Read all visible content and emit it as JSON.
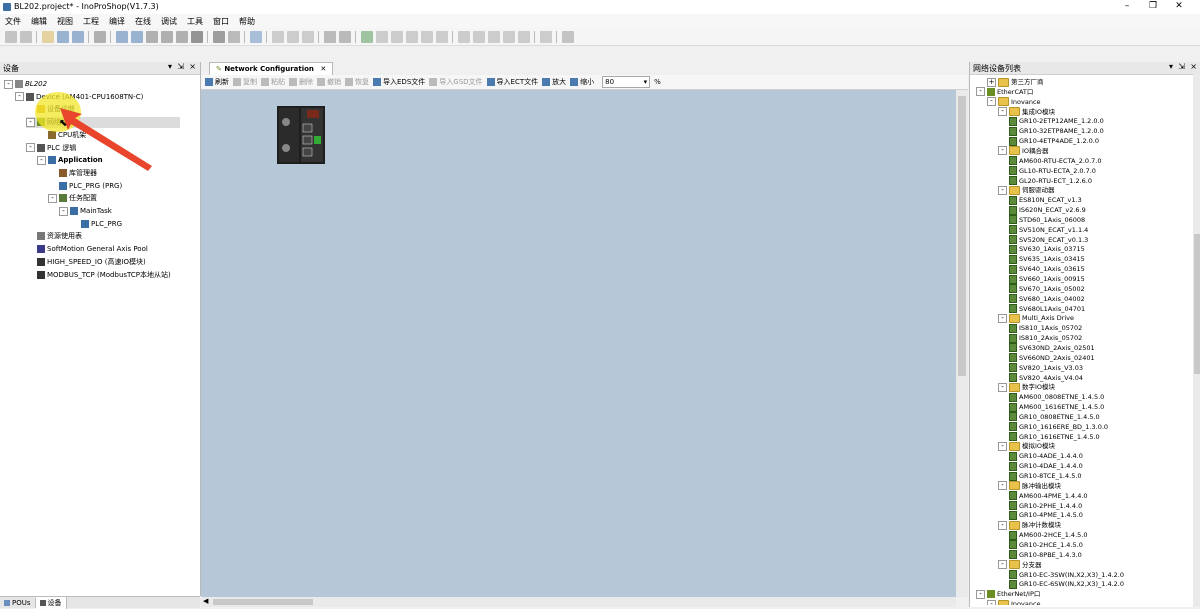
{
  "window": {
    "title": "BL202.project* - InoProShop(V1.7.3)"
  },
  "menu": [
    "文件",
    "编辑",
    "视图",
    "工程",
    "编译",
    "在线",
    "调试",
    "工具",
    "窗口",
    "帮助"
  ],
  "left_panel": {
    "title": "设备",
    "tree": [
      {
        "label": "BL202",
        "indent": 0,
        "exp": "-",
        "icon": "project"
      },
      {
        "label": "Device (AM401-CPU1608TN-C)",
        "indent": 1,
        "exp": "-",
        "icon": "device"
      },
      {
        "label": "设备诊断",
        "indent": 2,
        "exp": "",
        "icon": "diag"
      },
      {
        "label": "网络组态",
        "indent": 2,
        "exp": "-",
        "icon": "net"
      },
      {
        "label": "CPU机架",
        "indent": 3,
        "exp": "",
        "icon": "rack"
      },
      {
        "label": "PLC 逻辑",
        "indent": 2,
        "exp": "-",
        "icon": "plc"
      },
      {
        "label": "Application",
        "indent": 3,
        "exp": "-",
        "icon": "app"
      },
      {
        "label": "库管理器",
        "indent": 4,
        "exp": "",
        "icon": "lib"
      },
      {
        "label": "PLC_PRG (PRG)",
        "indent": 4,
        "exp": "",
        "icon": "prg"
      },
      {
        "label": "任务配置",
        "indent": 4,
        "exp": "-",
        "icon": "task"
      },
      {
        "label": "MainTask",
        "indent": 5,
        "exp": "-",
        "icon": "maintask"
      },
      {
        "label": "PLC_PRG",
        "indent": 6,
        "exp": "",
        "icon": "prg"
      },
      {
        "label": "资源使用表",
        "indent": 2,
        "exp": "",
        "icon": "res"
      },
      {
        "label": "SoftMotion General Axis Pool",
        "indent": 2,
        "exp": "",
        "icon": "axis"
      },
      {
        "label": "HIGH_SPEED_IO (高速IO模块)",
        "indent": 2,
        "exp": "",
        "icon": "hsio"
      },
      {
        "label": "MODBUS_TCP (ModbusTCP本地从站)",
        "indent": 2,
        "exp": "",
        "icon": "modbus"
      }
    ],
    "bottom_tabs": [
      "POUs",
      "设备"
    ]
  },
  "editor": {
    "tab_label": "Network Configuration",
    "toolbar": [
      {
        "label": "刷新",
        "disabled": false
      },
      {
        "label": "复制",
        "disabled": true
      },
      {
        "label": "粘贴",
        "disabled": true
      },
      {
        "label": "删除",
        "disabled": true
      },
      {
        "label": "撤销",
        "disabled": true
      },
      {
        "label": "恢复",
        "disabled": true
      },
      {
        "label": "导入EDS文件",
        "disabled": false
      },
      {
        "label": "导入GSD文件",
        "disabled": true
      },
      {
        "label": "导入ECT文件",
        "disabled": false
      },
      {
        "label": "放大",
        "disabled": false
      },
      {
        "label": "缩小",
        "disabled": false
      }
    ],
    "zoom": "80",
    "zoom_unit": "%"
  },
  "right_panel": {
    "title": "网络设备列表",
    "tree": [
      {
        "label": "第三方厂商",
        "indent": 1,
        "type": "folder",
        "exp": "+"
      },
      {
        "label": "EtherCAT口",
        "indent": 0,
        "type": "port",
        "exp": "-"
      },
      {
        "label": "Inovance",
        "indent": 1,
        "type": "folder",
        "exp": "-"
      },
      {
        "label": "集成IO模块",
        "indent": 2,
        "type": "folder",
        "exp": "-"
      },
      {
        "label": "GR10-2ETP12AME_1.2.0.0",
        "indent": 3,
        "type": "mod"
      },
      {
        "label": "GR10-32ETP8AME_1.2.0.0",
        "indent": 3,
        "type": "mod"
      },
      {
        "label": "GR10-4ETP4ADE_1.2.0.0",
        "indent": 3,
        "type": "mod"
      },
      {
        "label": "IO耦合器",
        "indent": 2,
        "type": "folder",
        "exp": "-"
      },
      {
        "label": "AM600-RTU-ECTA_2.0.7.0",
        "indent": 3,
        "type": "mod"
      },
      {
        "label": "GL10-RTU-ECTA_2.0.7.0",
        "indent": 3,
        "type": "mod"
      },
      {
        "label": "GL20-RTU-ECT_1.2.6.0",
        "indent": 3,
        "type": "mod"
      },
      {
        "label": "伺服驱动器",
        "indent": 2,
        "type": "folder",
        "exp": "-"
      },
      {
        "label": "ES810N_ECAT_v1.3",
        "indent": 3,
        "type": "mod"
      },
      {
        "label": "IS620N_ECAT_v2.6.9",
        "indent": 3,
        "type": "mod"
      },
      {
        "label": "STD60_1Axis_06008",
        "indent": 3,
        "type": "mod"
      },
      {
        "label": "SV510N_ECAT_v1.1.4",
        "indent": 3,
        "type": "mod"
      },
      {
        "label": "SV520N_ECAT_v0.1.3",
        "indent": 3,
        "type": "mod"
      },
      {
        "label": "SV630_1Axis_03715",
        "indent": 3,
        "type": "mod"
      },
      {
        "label": "SV635_1Axis_03415",
        "indent": 3,
        "type": "mod"
      },
      {
        "label": "SV640_1Axis_03615",
        "indent": 3,
        "type": "mod"
      },
      {
        "label": "SV660_1Axis_00915",
        "indent": 3,
        "type": "mod"
      },
      {
        "label": "SV670_1Axis_05002",
        "indent": 3,
        "type": "mod"
      },
      {
        "label": "SV680_1Axis_04002",
        "indent": 3,
        "type": "mod"
      },
      {
        "label": "SV680L1Axis_04701",
        "indent": 3,
        "type": "mod"
      },
      {
        "label": "Multi_Axis Drive",
        "indent": 2,
        "type": "folder",
        "exp": "-"
      },
      {
        "label": "IS810_1Axis_05702",
        "indent": 3,
        "type": "mod"
      },
      {
        "label": "IS810_2Axis_05702",
        "indent": 3,
        "type": "mod"
      },
      {
        "label": "SV630ND_2Axis_02501",
        "indent": 3,
        "type": "mod"
      },
      {
        "label": "SV660ND_2Axis_02401",
        "indent": 3,
        "type": "mod"
      },
      {
        "label": "SV820_1Axis_V3.03",
        "indent": 3,
        "type": "mod"
      },
      {
        "label": "SV820_4Axis_V4.04",
        "indent": 3,
        "type": "mod"
      },
      {
        "label": "数字IO模块",
        "indent": 2,
        "type": "folder",
        "exp": "-"
      },
      {
        "label": "AM600_0808ETNE_1.4.5.0",
        "indent": 3,
        "type": "mod"
      },
      {
        "label": "AM600_1616ETNE_1.4.5.0",
        "indent": 3,
        "type": "mod"
      },
      {
        "label": "GR10_0808ETNE_1.4.5.0",
        "indent": 3,
        "type": "mod"
      },
      {
        "label": "GR10_1616ERE_BD_1.3.0.0",
        "indent": 3,
        "type": "mod"
      },
      {
        "label": "GR10_1616ETNE_1.4.5.0",
        "indent": 3,
        "type": "mod"
      },
      {
        "label": "模拟IO模块",
        "indent": 2,
        "type": "folder",
        "exp": "-"
      },
      {
        "label": "GR10-4ADE_1.4.4.0",
        "indent": 3,
        "type": "mod"
      },
      {
        "label": "GR10-4DAE_1.4.4.0",
        "indent": 3,
        "type": "mod"
      },
      {
        "label": "GR10-8TCE_1.4.5.0",
        "indent": 3,
        "type": "mod"
      },
      {
        "label": "脉冲输出模块",
        "indent": 2,
        "type": "folder",
        "exp": "-"
      },
      {
        "label": "AM600-4PME_1.4.4.0",
        "indent": 3,
        "type": "mod"
      },
      {
        "label": "GR10-2PHE_1.4.4.0",
        "indent": 3,
        "type": "mod"
      },
      {
        "label": "GR10-4PME_1.4.5.0",
        "indent": 3,
        "type": "mod"
      },
      {
        "label": "脉冲计数模块",
        "indent": 2,
        "type": "folder",
        "exp": "-"
      },
      {
        "label": "AM600-2HCE_1.4.5.0",
        "indent": 3,
        "type": "mod"
      },
      {
        "label": "GR10-2HCE_1.4.5.0",
        "indent": 3,
        "type": "mod"
      },
      {
        "label": "GR10-8PBE_1.4.3.0",
        "indent": 3,
        "type": "mod"
      },
      {
        "label": "分支器",
        "indent": 2,
        "type": "folder",
        "exp": "-"
      },
      {
        "label": "GR10-EC-3SW(IN,X2,X3)_1.4.2.0",
        "indent": 3,
        "type": "mod"
      },
      {
        "label": "GR10-EC-6SW(IN,X2,X3)_1.4.2.0",
        "indent": 3,
        "type": "mod"
      },
      {
        "label": "EtherNet/IP口",
        "indent": 0,
        "type": "port",
        "exp": "-"
      },
      {
        "label": "Inovance",
        "indent": 1,
        "type": "folder",
        "exp": "-"
      }
    ]
  },
  "colors": {
    "canvas": "#b6c8d8",
    "highlight": "#f2e62a",
    "arrow": "#e8452c"
  }
}
